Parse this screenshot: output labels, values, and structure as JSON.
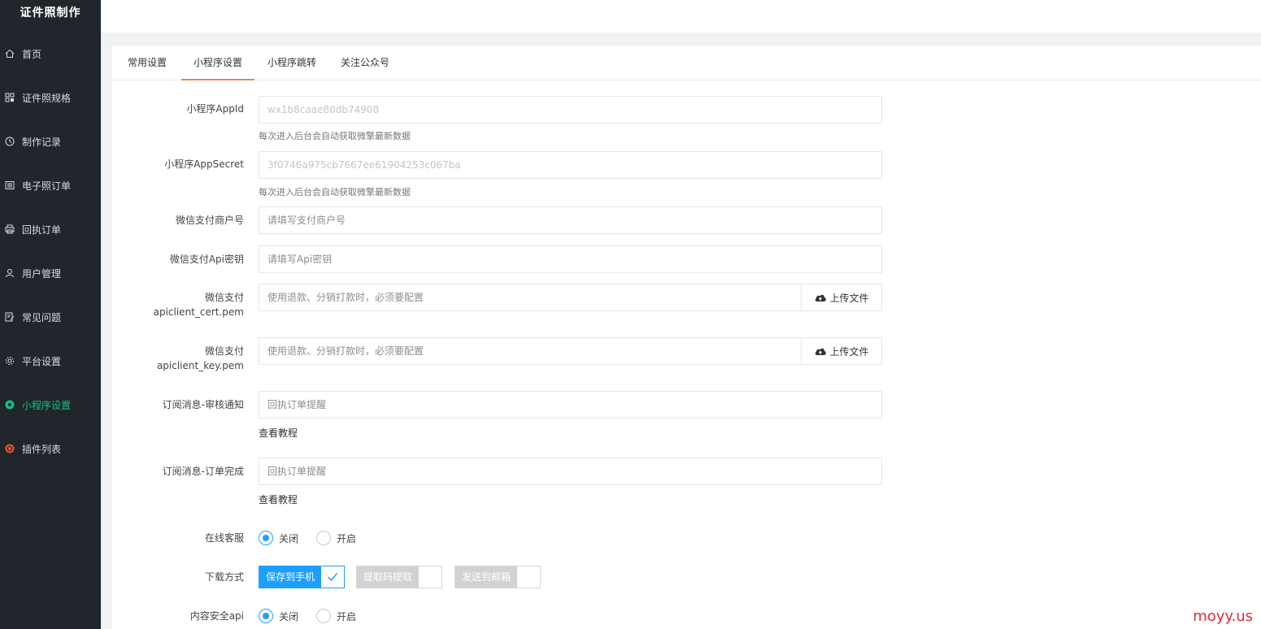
{
  "sidebar": {
    "brand": "证件照制作",
    "items": [
      {
        "label": "首页",
        "icon": "home-icon",
        "active": false
      },
      {
        "label": "证件照规格",
        "icon": "grid-icon",
        "active": false
      },
      {
        "label": "制作记录",
        "icon": "clock-icon",
        "active": false
      },
      {
        "label": "电子照订单",
        "icon": "list-icon",
        "active": false
      },
      {
        "label": "回执订单",
        "icon": "printer-icon",
        "active": false
      },
      {
        "label": "用户管理",
        "icon": "user-icon",
        "active": false
      },
      {
        "label": "常见问题",
        "icon": "edit-doc-icon",
        "active": false
      },
      {
        "label": "平台设置",
        "icon": "gear-icon",
        "active": false
      },
      {
        "label": "小程序设置",
        "icon": "mini-program-icon",
        "active": true
      },
      {
        "label": "插件列表",
        "icon": "plugin-icon",
        "active": false
      }
    ]
  },
  "tabs": [
    {
      "label": "常用设置",
      "active": false
    },
    {
      "label": "小程序设置",
      "active": true
    },
    {
      "label": "小程序跳转",
      "active": false
    },
    {
      "label": "关注公众号",
      "active": false
    }
  ],
  "form": {
    "appid": {
      "label": "小程序AppId",
      "value": "wx1b8caae80db74908",
      "hint": "每次进入后台会自动获取微擎最新数据"
    },
    "appsecret": {
      "label": "小程序AppSecret",
      "value": "3f0746a975cb7667ee61904253c067ba",
      "hint": "每次进入后台会自动获取微擎最新数据"
    },
    "mchid": {
      "label": "微信支付商户号",
      "placeholder": "请填写支付商户号"
    },
    "apikey": {
      "label": "微信支付Api密钥",
      "placeholder": "请填写Api密钥"
    },
    "cert": {
      "label_line1": "微信支付",
      "label_line2": "apiclient_cert.pem",
      "placeholder": "使用退款、分销打款时，必须要配置",
      "button": "上传文件"
    },
    "key": {
      "label_line1": "微信支付",
      "label_line2": "apiclient_key.pem",
      "placeholder": "使用退款、分销打款时，必须要配置",
      "button": "上传文件"
    },
    "sub_audit": {
      "label": "订阅消息-审核通知",
      "placeholder": "回执订单提醒",
      "link": "查看教程"
    },
    "sub_done": {
      "label": "订阅消息-订单完成",
      "placeholder": "回执订单提醒",
      "link": "查看教程"
    },
    "service": {
      "label": "在线客服",
      "options": [
        "关闭",
        "开启"
      ],
      "selected": "关闭"
    },
    "download": {
      "label": "下载方式",
      "options": [
        {
          "text": "保存到手机",
          "checked": true
        },
        {
          "text": "提取码提取",
          "checked": false
        },
        {
          "text": "发送到邮箱",
          "checked": false
        }
      ]
    },
    "security": {
      "label": "内容安全api",
      "options": [
        "关闭",
        "开启"
      ],
      "selected": "关闭"
    }
  },
  "colors": {
    "sidebar_bg": "#20262b",
    "accent_green": "#12c47f",
    "primary_blue": "#1e9fff",
    "tab_underline": "#e18a55"
  },
  "watermark": "moyy.us"
}
